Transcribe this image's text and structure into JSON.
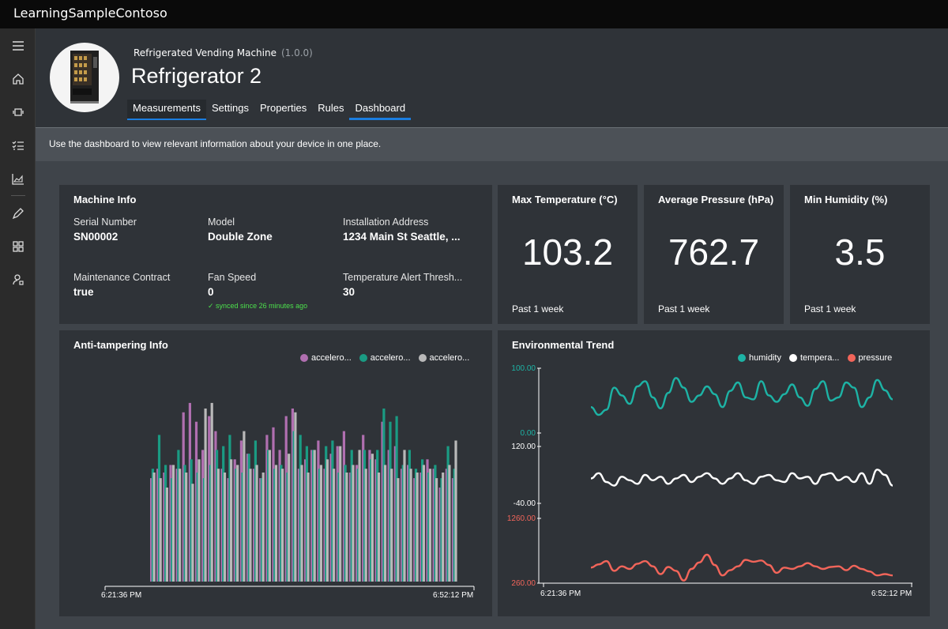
{
  "app": {
    "title": "LearningSampleContoso"
  },
  "sidebar": {
    "items": [
      {
        "name": "menu-icon"
      },
      {
        "name": "home-icon"
      },
      {
        "name": "devices-icon"
      },
      {
        "name": "rules-icon"
      },
      {
        "name": "analytics-icon"
      },
      {
        "name": "edit-icon"
      },
      {
        "name": "apps-icon"
      },
      {
        "name": "user-settings-icon"
      }
    ]
  },
  "device": {
    "template": "Refrigerated Vending Machine",
    "version": "(1.0.0)",
    "name": "Refrigerator 2"
  },
  "tabs": [
    {
      "label": "Measurements"
    },
    {
      "label": "Settings"
    },
    {
      "label": "Properties"
    },
    {
      "label": "Rules"
    },
    {
      "label": "Dashboard"
    }
  ],
  "description": "Use the dashboard to view relevant information about your device in one place.",
  "machine_info": {
    "title": "Machine Info",
    "props": [
      {
        "label": "Serial Number",
        "value": "SN00002"
      },
      {
        "label": "Model",
        "value": "Double Zone"
      },
      {
        "label": "Installation Address",
        "value": "1234 Main St Seattle, ..."
      },
      {
        "label": "Maintenance Contract",
        "value": "true"
      },
      {
        "label": "Fan Speed",
        "value": "0"
      },
      {
        "label": "Temperature Alert Thresh...",
        "value": "30"
      }
    ],
    "sync_note": "✓ synced since 26 minutes ago"
  },
  "kpis": [
    {
      "title": "Max Temperature (°C)",
      "value": "103.2",
      "foot": "Past 1 week"
    },
    {
      "title": "Average Pressure (hPa)",
      "value": "762.7",
      "foot": "Past 1 week"
    },
    {
      "title": "Min Humidity (%)",
      "value": "3.5",
      "foot": "Past 1 week"
    }
  ],
  "chart_data": [
    {
      "type": "bar",
      "title": "Anti-tampering Info",
      "x_range": [
        "6:21:36 PM",
        "6:52:12 PM"
      ],
      "legend": [
        {
          "name": "accelero...",
          "color": "#b06fb0"
        },
        {
          "name": "accelero...",
          "color": "#1a9b83"
        },
        {
          "name": "accelero...",
          "color": "#b9b9b9"
        }
      ],
      "legend_position": "top-right",
      "series": [
        {
          "name": "accelero...",
          "color": "#b06fb0",
          "values": [
            55,
            60,
            58,
            62,
            60,
            90,
            95,
            85,
            70,
            88,
            80,
            60,
            55,
            65,
            75,
            68,
            60,
            55,
            78,
            82,
            70,
            88,
            92,
            60,
            65,
            70,
            75,
            60,
            68,
            72,
            80,
            58,
            62,
            78,
            70,
            65,
            85,
            70,
            72,
            60,
            62,
            55,
            58,
            65,
            60,
            50,
            60,
            55
          ]
        },
        {
          "name": "accelero...",
          "color": "#1a9b83",
          "values": [
            60,
            78,
            62,
            55,
            70,
            62,
            65,
            58,
            55,
            62,
            70,
            72,
            78,
            60,
            58,
            68,
            75,
            55,
            70,
            60,
            62,
            58,
            80,
            78,
            72,
            70,
            60,
            72,
            75,
            58,
            62,
            70,
            60,
            70,
            65,
            70,
            92,
            85,
            88,
            62,
            70,
            60,
            65,
            58,
            62,
            55,
            72,
            60
          ]
        },
        {
          "name": "accelero...",
          "color": "#b9b9b9",
          "values": [
            58,
            55,
            50,
            62,
            60,
            58,
            52,
            65,
            92,
            95,
            60,
            58,
            65,
            62,
            80,
            60,
            62,
            58,
            70,
            62,
            60,
            68,
            90,
            62,
            58,
            70,
            62,
            65,
            60,
            72,
            58,
            62,
            70,
            60,
            68,
            58,
            62,
            60,
            55,
            70,
            60,
            58,
            62,
            60,
            55,
            58,
            62,
            75
          ]
        }
      ]
    },
    {
      "type": "line",
      "title": "Environmental Trend",
      "x_range": [
        "6:21:36 PM",
        "6:52:12 PM"
      ],
      "legend_position": "top-right",
      "series": [
        {
          "name": "humidity",
          "color": "#1db3a5",
          "ylim": [
            0,
            100
          ],
          "tick_labels": [
            "100.00",
            "0.00"
          ],
          "values": [
            40,
            28,
            36,
            70,
            58,
            45,
            72,
            80,
            55,
            38,
            62,
            85,
            70,
            48,
            58,
            72,
            60,
            40,
            65,
            78,
            55,
            52,
            80,
            58,
            48,
            60,
            75,
            55,
            42,
            68,
            80,
            50,
            55,
            78,
            70,
            40,
            55,
            82,
            66,
            52
          ]
        },
        {
          "name": "tempera...",
          "color": "#ffffff",
          "ylim": [
            -40,
            120
          ],
          "tick_labels": [
            "120.00",
            "-40.00"
          ],
          "values": [
            30,
            45,
            20,
            10,
            35,
            25,
            15,
            40,
            25,
            35,
            15,
            30,
            40,
            20,
            35,
            45,
            30,
            15,
            30,
            45,
            25,
            15,
            35,
            40,
            25,
            20,
            45,
            30,
            35,
            15,
            40,
            45,
            25,
            35,
            20,
            45,
            15,
            55,
            40,
            10
          ]
        },
        {
          "name": "pressure",
          "color": "#f2655a",
          "ylim": [
            260,
            1260
          ],
          "tick_labels": [
            "1260.00",
            "260.00"
          ],
          "values": [
            500,
            550,
            600,
            450,
            520,
            480,
            560,
            600,
            520,
            400,
            510,
            450,
            300,
            480,
            580,
            700,
            540,
            380,
            460,
            520,
            620,
            590,
            610,
            540,
            420,
            500,
            480,
            520,
            570,
            520,
            480,
            510,
            520,
            460,
            530,
            480,
            440,
            380,
            400,
            380
          ]
        }
      ]
    }
  ]
}
